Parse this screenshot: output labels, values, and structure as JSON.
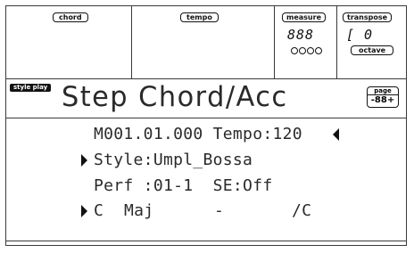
{
  "header": {
    "chord_label": "chord",
    "tempo_label": "tempo",
    "measure_label": "measure",
    "measure_value": "888",
    "transpose_label": "transpose",
    "transpose_value": "[ 0",
    "octave_label": "octave"
  },
  "title_bar": {
    "mode_badge": "style play",
    "title": "Step Chord/Acc",
    "page_label": "page",
    "page_value": "-88+"
  },
  "content": {
    "position_line": "M001.01.000 Tempo:120",
    "style_line": "Style:Umpl_Bossa",
    "perf_line": "Perf :01-1  SE:Off",
    "chord_root": "C",
    "chord_type": "Maj",
    "chord_dash": "-",
    "chord_bass": "/C"
  }
}
